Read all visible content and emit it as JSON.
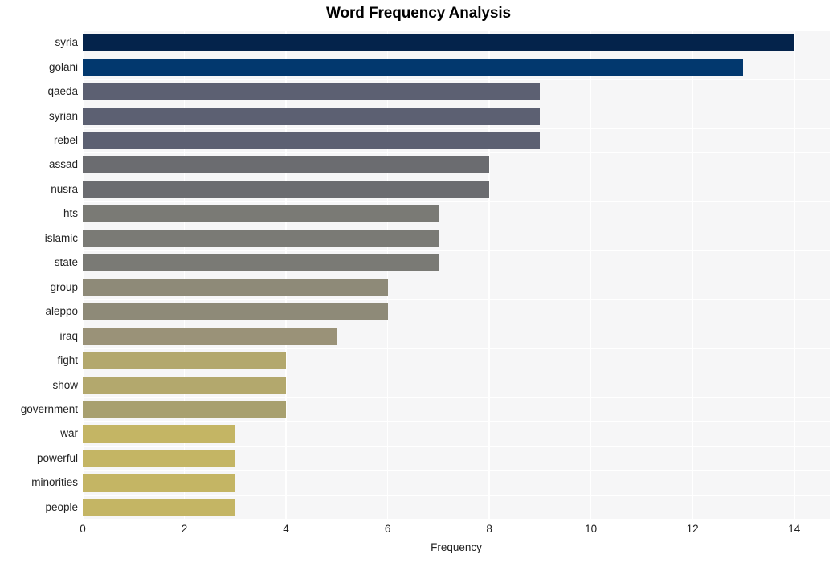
{
  "chart_data": {
    "type": "bar",
    "orientation": "horizontal",
    "title": "Word Frequency Analysis",
    "xlabel": "Frequency",
    "ylabel": "",
    "xlim": [
      0,
      14.7
    ],
    "ylim": [
      0,
      20
    ],
    "grid": true,
    "legend": null,
    "xticks": [
      0,
      2,
      4,
      6,
      8,
      10,
      12,
      14
    ],
    "xtick_labels": [
      "0",
      "2",
      "4",
      "6",
      "8",
      "10",
      "12",
      "14"
    ],
    "categories": [
      "syria",
      "golani",
      "qaeda",
      "syrian",
      "rebel",
      "assad",
      "nusra",
      "hts",
      "islamic",
      "state",
      "group",
      "aleppo",
      "iraq",
      "fight",
      "show",
      "government",
      "war",
      "powerful",
      "minorities",
      "people"
    ],
    "values": [
      14,
      13,
      9,
      9,
      9,
      8,
      8,
      7,
      7,
      7,
      6,
      6,
      5,
      4,
      4,
      4,
      3,
      3,
      3,
      3
    ],
    "bar_colors": [
      "#04234b",
      "#02386e",
      "#5c6072",
      "#5c6072",
      "#5c6072",
      "#6b6c70",
      "#6b6c70",
      "#7a7a75",
      "#7a7a75",
      "#7a7a75",
      "#8e8a78",
      "#8e8a78",
      "#9a9278",
      "#b3a86d",
      "#b3a86d",
      "#a8a06f",
      "#c4b564",
      "#c4b564",
      "#c4b564",
      "#c4b564"
    ],
    "plot_bg": "#f6f6f7",
    "grid_color": "#ffffff",
    "figure_bg": "#ffffff"
  },
  "axis": {
    "x_title": "Frequency"
  }
}
